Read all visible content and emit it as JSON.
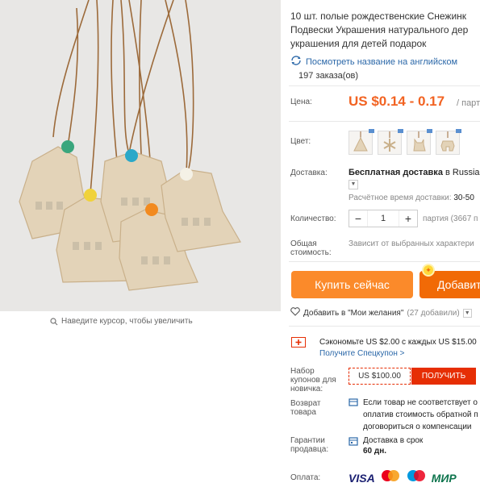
{
  "product": {
    "title_lines": [
      "10 шт. полые рождественские Снежинк",
      "Подвески Украшения натурального дер",
      "украшения для детей подарок"
    ],
    "translate_link": "Посмотреть название на английском",
    "orders": "197 заказа(ов)",
    "zoom_hint": "Наведите курсор, чтобы увеличить",
    "image_icon": "wooden-bell-ornaments-photo"
  },
  "price": {
    "label": "Цена:",
    "value": "US $0.14 - 0.17",
    "unit": "/ парт",
    "color": "#f26322"
  },
  "color_option": {
    "label": "Цвет:",
    "swatches": [
      "tree-ornament-icon",
      "snowflake-ornament-icon",
      "deer-ornament-icon",
      "reindeer-ornament-icon"
    ]
  },
  "shipping": {
    "label": "Доставка:",
    "free_text": "Бесплатная доставка",
    "to_text": " в Russian",
    "time_label": "Расчётное время доставки:",
    "time_value": " 30-50"
  },
  "quantity": {
    "label": "Количество:",
    "minus": "−",
    "value": "1",
    "plus": "+",
    "note": "партия (3667 п"
  },
  "total": {
    "label": "Общая\nстоимость:",
    "note": "Зависит от выбранных характери"
  },
  "actions": {
    "buy_now": "Купить сейчас",
    "add_to_cart": "Добавит",
    "wishlist": "Добавить в \"Мои желания\"",
    "wishlist_count": "(27 добавили)"
  },
  "coupon": {
    "save_text": "Сэкономьте US $2.00 с каждых US $15.00",
    "save_link": "Получите Спецкупон >",
    "newbie_label": "Набор\nкупонов для\nновичка:",
    "newbie_value": "US $100.00",
    "get_button": "ПОЛУЧИТЬ"
  },
  "returns": {
    "label": "Возврат\nтовара",
    "text": "Если товар не соответствует о\nоплатив стоимость обратной п\nдоговориться о компенсации"
  },
  "guarantee": {
    "label": "Гарантии\nпродавца:",
    "text": "Доставка в срок",
    "days": "60 дн."
  },
  "payment": {
    "label": "Оплата:",
    "methods": [
      "VISA",
      "МИР"
    ]
  },
  "colors": {
    "accent_orange": "#fb8a2a",
    "cart_orange": "#f16a06",
    "coupon_red": "#e62e04",
    "link_blue": "#2a67a8"
  }
}
